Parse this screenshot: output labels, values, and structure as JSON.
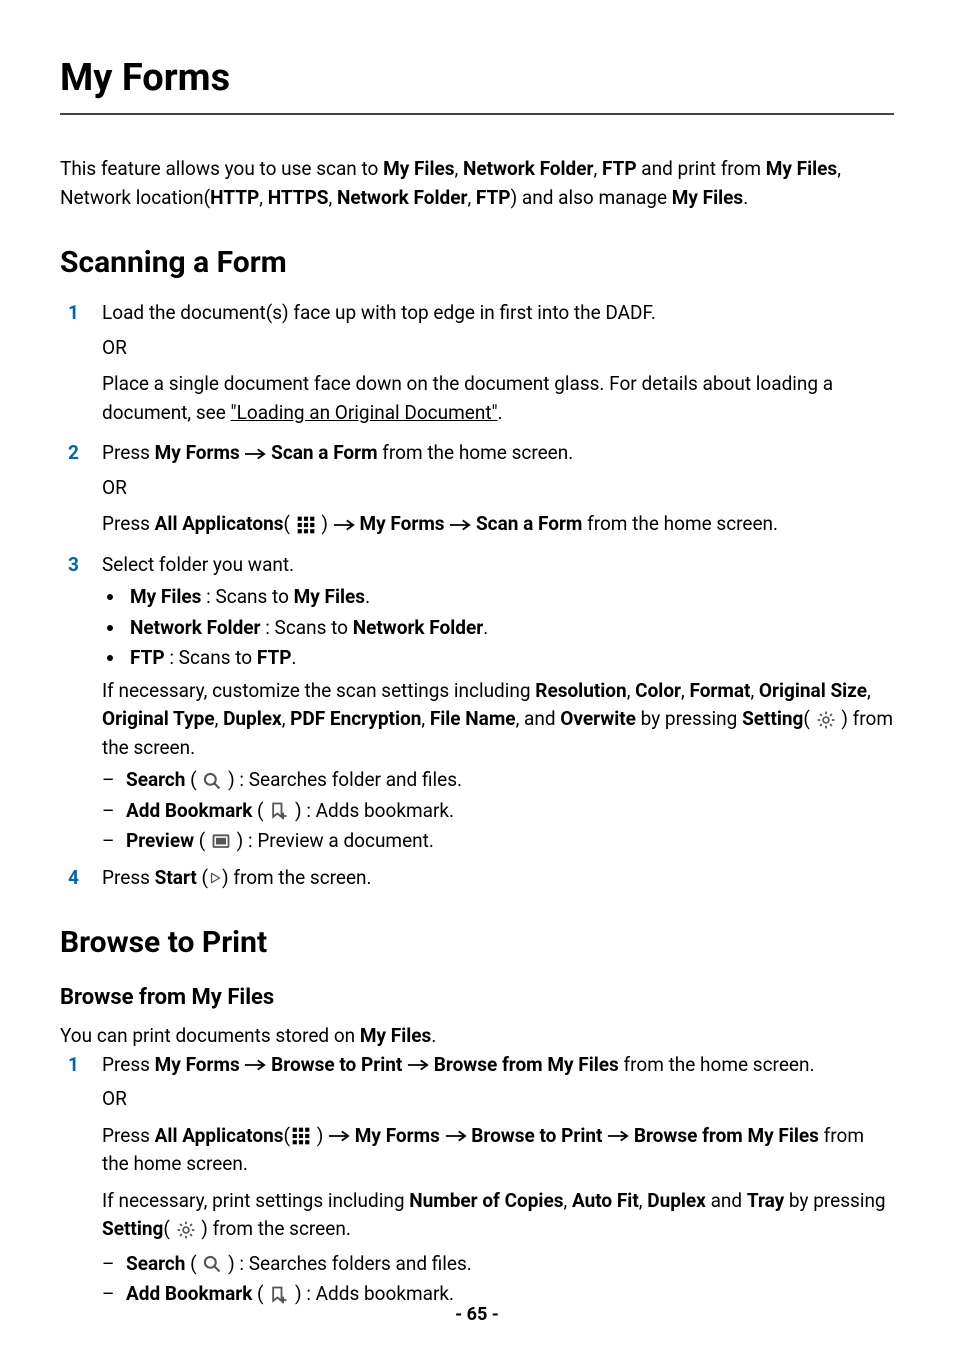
{
  "title": "My Forms",
  "intro": {
    "t1": "This feature allows you to use scan to ",
    "b1": "My Files",
    "c1": ", ",
    "b2": "Network Folder",
    "c2": ", ",
    "b3": "FTP",
    "t2": " and print from ",
    "b4": "My Files",
    "t3": ", Network location(",
    "b5": "HTTP",
    "c3": ", ",
    "b6": "HTTPS",
    "c4": ", ",
    "b7": "Network Folder",
    "c5": ", ",
    "b8": "FTP",
    "t4": ") and also manage ",
    "b9": "My Files",
    "t5": "."
  },
  "scan": {
    "heading": "Scanning a Form",
    "step1": {
      "num": "1",
      "text": "Load the document(s) face up with top edge in first into the DADF.",
      "or": "OR",
      "text2a": "Place a single document face down on the document glass. For details about loading a document, see ",
      "link": "\"Loading an Original Document\"",
      "text2b": "."
    },
    "step2": {
      "num": "2",
      "press": "Press ",
      "b1": "My Forms",
      "space1": " ",
      "b2": " Scan a Form",
      "after": " from the home screen.",
      "or": "OR",
      "press2": "Press ",
      "b3": "All Applicatons",
      "openp": "(",
      "closep": " ) ",
      "b4": " My Forms ",
      "b5": " Scan a Form",
      "after2": " from the home screen."
    },
    "step3": {
      "num": "3",
      "text": "Select folder you want.",
      "bullets": {
        "a1": "My Files",
        "a2": " : Scans to ",
        "a3": "My Files",
        "a4": ".",
        "b1": "Network Folder",
        "b2": " : Scans to ",
        "b3": "Network Folder",
        "b4": ".",
        "c1": "FTP",
        "c2": " : Scans to ",
        "c3": "FTP",
        "c4": "."
      },
      "custom": {
        "t1": "If necessary, customize the scan settings including ",
        "b1": "Resolution",
        "c1": ", ",
        "b2": "Color",
        "c2": ", ",
        "b3": "Format",
        "c3": ", ",
        "b4": "Original Size",
        "c4": ", ",
        "b5": "Original Type",
        "c5": ", ",
        "b6": "Duplex",
        "c6": ", ",
        "b7": "PDF Encryption",
        "c7": ", ",
        "b8": "File Name",
        "t2": ", and ",
        "b9": "Overwite",
        "t3": " by pressing ",
        "b10": "Setting",
        "openp": "( ",
        "closep": " ) from the screen."
      },
      "dashes": {
        "s1": "Search",
        "s2": " ( ",
        "s3": " ) : Searches folder and files.",
        "a1": "Add Bookmark",
        "a2": " ( ",
        "a3": " ) : Adds bookmark.",
        "p1": "Preview",
        "p2": " ( ",
        "p3": " ) : Preview a document."
      }
    },
    "step4": {
      "num": "4",
      "press": "Press ",
      "b1": "Start",
      "paren1": " (",
      "paren2": ") from the screen."
    }
  },
  "browse": {
    "heading": "Browse to Print",
    "sub": "Browse from My Files",
    "intro1": "You can print documents stored on ",
    "introb": "My Files",
    "intro2": ".",
    "step1": {
      "num": "1",
      "press": "Press ",
      "b1": "My Forms ",
      "b2": " Browse to Print ",
      "b3": " Browse from My Files",
      "after": " from the home screen.",
      "or": "OR",
      "press2": "Press ",
      "b4": "All Applicatons",
      "openp": "(",
      "closep": " ) ",
      "b5": " My Forms ",
      "b6": " Browse to Print ",
      "b7": " Browse from My Files",
      "after2": " from the home screen.",
      "settings": {
        "t1": "If necessary, print settings including ",
        "b1": "Number of Copies",
        "c1": ", ",
        "b2": "Auto Fit",
        "c2": ", ",
        "b3": "Duplex",
        "t2": " and ",
        "b4": "Tray",
        "t3": " by pressing ",
        "b5": "Setting",
        "openp": "( ",
        "closep": " ) from the screen."
      },
      "dashes": {
        "s1": "Search",
        "s2": " ( ",
        "s3": " ) : Searches folders and files.",
        "a1": "Add Bookmark",
        "a2": " ( ",
        "a3": " ) : Adds bookmark."
      }
    }
  },
  "pagenum": "- 65 -"
}
